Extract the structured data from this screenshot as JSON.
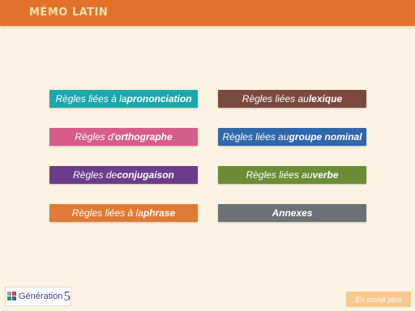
{
  "header": {
    "title": "MÉMO LATIN"
  },
  "buttons": [
    {
      "pre": "Règles liées à la ",
      "bold": "prononciation",
      "color": "#1aa8aa"
    },
    {
      "pre": "Règles liées au ",
      "bold": "lexique",
      "color": "#7b4a3e"
    },
    {
      "pre": "Règles d'",
      "bold": "orthographe",
      "color": "#d65d8a"
    },
    {
      "pre": "Règles liées au ",
      "bold": "groupe nominal",
      "color": "#2f68aa"
    },
    {
      "pre": "Règles de ",
      "bold": "conjugaison",
      "color": "#6b3c8c"
    },
    {
      "pre": "Règles liées au ",
      "bold": "verbe",
      "color": "#6a8d35"
    },
    {
      "pre": "Règles liées à la ",
      "bold": "phrase",
      "color": "#e07a35"
    },
    {
      "pre": "",
      "bold": "Annexes",
      "color": "#6b7177"
    }
  ],
  "logo": {
    "text": "Génération",
    "number": "5"
  },
  "footer": {
    "more_label": "En savoir plus"
  }
}
